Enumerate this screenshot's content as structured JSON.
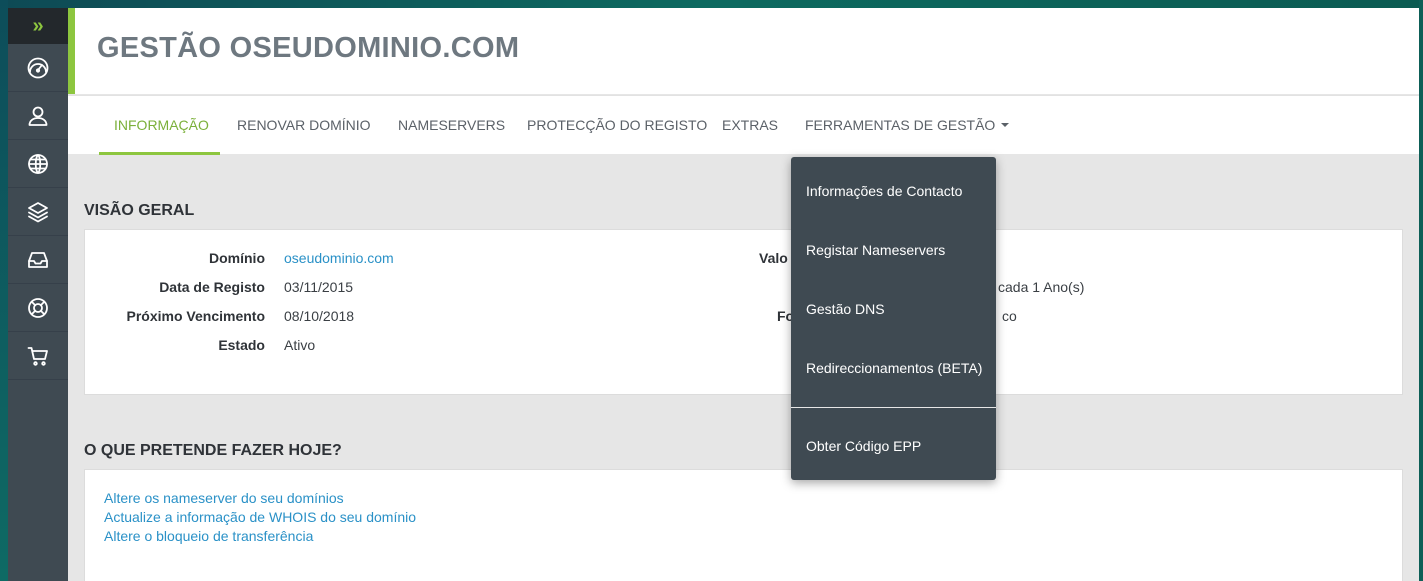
{
  "page": {
    "title": "GESTÃO OSEUDOMINIO.COM"
  },
  "tabs": [
    {
      "label": "INFORMAÇÃO",
      "active": true
    },
    {
      "label": "RENOVAR DOMÍNIO"
    },
    {
      "label": "NAMESERVERS"
    },
    {
      "label": "PROTECÇÃO DO REGISTO"
    },
    {
      "label": "EXTRAS"
    },
    {
      "label": "FERRAMENTAS DE GESTÃO"
    }
  ],
  "overview": {
    "title": "VISÃO GERAL",
    "rows": [
      {
        "label": "Domínio",
        "value": "oseudominio.com"
      },
      {
        "label": "Data de Registo",
        "value": "03/11/2015"
      },
      {
        "label": "Próximo Vencimento",
        "value": "08/10/2018"
      },
      {
        "label": "Estado",
        "value": "Ativo"
      }
    ],
    "partial_right": {
      "label_1": "Valo",
      "label_2": "Fo",
      "value_1": "cada 1 Ano(s)",
      "value_2": "co"
    }
  },
  "actions": {
    "title": "O QUE PRETENDE FAZER HOJE?",
    "links": [
      "Altere os nameserver do seu domínios",
      "Actualize a informação de WHOIS do seu domínio",
      "Altere o bloqueio de transferência"
    ]
  },
  "dropdown": {
    "items": [
      "Informações de Contacto",
      "Registar Nameservers",
      "Gestão DNS",
      "Redireccionamentos (BETA)",
      "Obter Código EPP"
    ]
  },
  "sidebar": {
    "toggle": "»",
    "icons": [
      "dashboard-icon",
      "user-icon",
      "globe-icon",
      "layers-icon",
      "inbox-icon",
      "support-icon",
      "cart-icon"
    ]
  },
  "colors": {
    "accent": "#8dc63f",
    "sidebar": "#3f4a52",
    "link": "#2a91c7",
    "active_tab": "#7bb03a"
  }
}
